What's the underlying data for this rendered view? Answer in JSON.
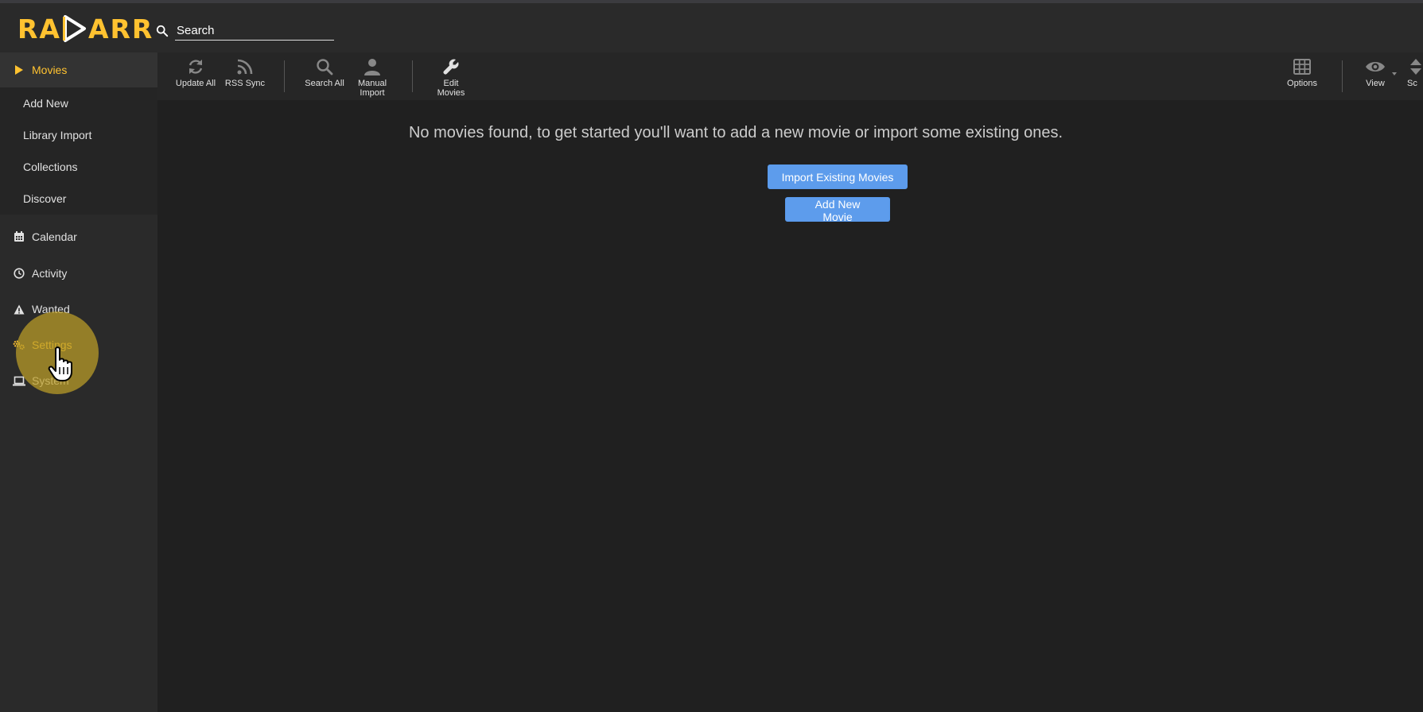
{
  "app": {
    "logo_text_left": "RA",
    "logo_text_right": "ARR",
    "accent_color": "#ffc230",
    "button_color": "#5d9cec"
  },
  "search": {
    "placeholder": "Search",
    "icon": "search-icon"
  },
  "sidebar": {
    "items": [
      {
        "label": "Movies",
        "icon": "play-icon",
        "active": true
      },
      {
        "label": "Add New"
      },
      {
        "label": "Library Import"
      },
      {
        "label": "Collections"
      },
      {
        "label": "Discover"
      },
      {
        "label": "Calendar",
        "icon": "calendar-icon"
      },
      {
        "label": "Activity",
        "icon": "clock-icon"
      },
      {
        "label": "Wanted",
        "icon": "warning-icon"
      },
      {
        "label": "Settings",
        "icon": "cogs-icon",
        "hovered": true
      },
      {
        "label": "System",
        "icon": "laptop-icon"
      }
    ]
  },
  "toolbar": {
    "update_all": "Update All",
    "rss_sync": "RSS Sync",
    "search_all": "Search All",
    "manual_import_1": "Manual",
    "manual_import_2": "Import",
    "edit_movies_1": "Edit",
    "edit_movies_2": "Movies",
    "options": "Options",
    "view": "View",
    "sort_partial": "Sc"
  },
  "main": {
    "empty_message": "No movies found, to get started you'll want to add a new movie or import some existing ones.",
    "import_button": "Import Existing Movies",
    "add_button": "Add New Movie"
  }
}
